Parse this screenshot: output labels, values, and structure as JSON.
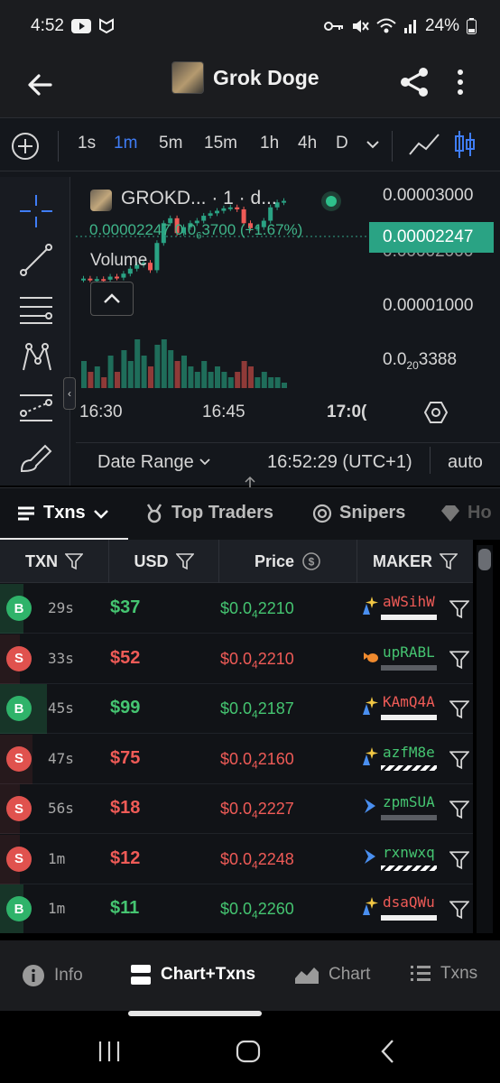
{
  "status_bar": {
    "time": "4:52",
    "battery": "24%"
  },
  "header": {
    "title": "Grok Doge"
  },
  "timeframes": [
    "1s",
    "1m",
    "5m",
    "15m",
    "1h",
    "4h",
    "D"
  ],
  "active_timeframe": "1m",
  "chart": {
    "symbol_title": "GROKD... · 1 · d...",
    "ohlc_prefix": "0.00002247",
    "ohlc_mid": "0.0",
    "ohlc_sub": "6",
    "ohlc_suffix": "3700 (+1.67%)",
    "volume_label": "Volume",
    "current_price_tag": "0.00002247",
    "y_labels": {
      "top": "0.00003000",
      "mid2": "0.00002000",
      "mid1": "0.00001000",
      "low_prefix": "0.0",
      "low_sub": "20",
      "low_suffix": "3388"
    },
    "x_labels": [
      "16:30",
      "16:45",
      "17:0("
    ],
    "date_range_label": "Date Range",
    "time_readout": "16:52:29 (UTC+1)",
    "scale_mode": "auto"
  },
  "chart_data": {
    "type": "candlestick",
    "title": "GROKD... · 1 · d...",
    "xlabel": "",
    "ylabel": "",
    "x_ticks": [
      "16:30",
      "16:45",
      "17:0("
    ],
    "y_ticks": [
      "0.00003000",
      "0.00002000",
      "0.00001000",
      "0.0₂₀3388"
    ],
    "last_price": 2.247e-05,
    "candles": [
      {
        "o": 6.6e-06,
        "c": 6.8e-06,
        "up": true
      },
      {
        "o": 6.8e-06,
        "c": 6.6e-06,
        "up": false
      },
      {
        "o": 6.6e-06,
        "c": 6.7e-06,
        "up": true
      },
      {
        "o": 6.7e-06,
        "c": 6.6e-06,
        "up": false
      },
      {
        "o": 6.6e-06,
        "c": 7.2e-06,
        "up": true
      },
      {
        "o": 7.2e-06,
        "c": 7e-06,
        "up": false
      },
      {
        "o": 7e-06,
        "c": 7.8e-06,
        "up": true
      },
      {
        "o": 7.8e-06,
        "c": 8.8e-06,
        "up": true
      },
      {
        "o": 8.8e-06,
        "c": 9.6e-06,
        "up": true
      },
      {
        "o": 9.6e-06,
        "c": 1e-05,
        "up": true
      },
      {
        "o": 1e-05,
        "c": 8.5e-06,
        "up": false
      },
      {
        "o": 8.5e-06,
        "c": 1.4e-05,
        "up": true
      },
      {
        "o": 1.4e-05,
        "c": 1.8e-05,
        "up": true
      },
      {
        "o": 1.8e-05,
        "c": 1.9e-05,
        "up": true
      },
      {
        "o": 1.9e-05,
        "c": 1.6e-05,
        "up": false
      },
      {
        "o": 1.6e-05,
        "c": 1.72e-05,
        "up": true
      },
      {
        "o": 1.72e-05,
        "c": 1.8e-05,
        "up": true
      },
      {
        "o": 1.8e-05,
        "c": 1.85e-05,
        "up": true
      },
      {
        "o": 1.85e-05,
        "c": 1.95e-05,
        "up": true
      },
      {
        "o": 1.95e-05,
        "c": 2e-05,
        "up": true
      },
      {
        "o": 2e-05,
        "c": 2.05e-05,
        "up": true
      },
      {
        "o": 2.05e-05,
        "c": 2.1e-05,
        "up": true
      },
      {
        "o": 2.1e-05,
        "c": 2.12e-05,
        "up": true
      },
      {
        "o": 2.12e-05,
        "c": 2.08e-05,
        "up": false
      },
      {
        "o": 2.08e-05,
        "c": 1.8e-05,
        "up": false
      },
      {
        "o": 1.8e-05,
        "c": 1.7e-05,
        "up": false
      },
      {
        "o": 1.7e-05,
        "c": 1.72e-05,
        "up": true
      },
      {
        "o": 1.72e-05,
        "c": 1.85e-05,
        "up": true
      },
      {
        "o": 1.85e-05,
        "c": 2.12e-05,
        "up": true
      },
      {
        "o": 2.12e-05,
        "c": 2.22e-05,
        "up": true
      },
      {
        "o": 2.22e-05,
        "c": 2.25e-05,
        "up": true
      }
    ],
    "volumes": [
      0.5,
      0.3,
      0.4,
      0.2,
      0.6,
      0.3,
      0.7,
      0.5,
      0.9,
      0.6,
      0.4,
      0.8,
      0.9,
      0.7,
      0.5,
      0.6,
      0.4,
      0.3,
      0.5,
      0.3,
      0.4,
      0.3,
      0.2,
      0.3,
      0.5,
      0.4,
      0.2,
      0.3,
      0.2,
      0.2,
      0.1
    ]
  },
  "tabs": [
    {
      "label": "Txns",
      "icon": "list-icon"
    },
    {
      "label": "Top Traders",
      "icon": "medal-icon"
    },
    {
      "label": "Snipers",
      "icon": "target-icon"
    },
    {
      "label": "Ho",
      "icon": "diamond-icon"
    }
  ],
  "table": {
    "headers": {
      "txn": "TXN",
      "usd": "USD",
      "price": "Price",
      "maker": "MAKER"
    },
    "rows": [
      {
        "type": "B",
        "age": "29s",
        "usd": "$37",
        "price_prefix": "$0.0",
        "price_sub": "4",
        "price_suffix": "2210",
        "maker": "aWSihW",
        "maker_icon": "sparkle-icon",
        "bar": "solid"
      },
      {
        "type": "S",
        "age": "33s",
        "usd": "$52",
        "price_prefix": "$0.0",
        "price_sub": "4",
        "price_suffix": "2210",
        "maker": "upRABL",
        "maker_icon": "fish-icon",
        "bar": "gray"
      },
      {
        "type": "B",
        "age": "45s",
        "usd": "$99",
        "price_prefix": "$0.0",
        "price_sub": "4",
        "price_suffix": "2187",
        "maker": "KAmQ4A",
        "maker_icon": "sparkle-icon",
        "bar": "solid"
      },
      {
        "type": "S",
        "age": "47s",
        "usd": "$75",
        "price_prefix": "$0.0",
        "price_sub": "4",
        "price_suffix": "2160",
        "maker": "azfM8e",
        "maker_icon": "sparkle-icon",
        "bar": "striped"
      },
      {
        "type": "S",
        "age": "56s",
        "usd": "$18",
        "price_prefix": "$0.0",
        "price_sub": "4",
        "price_suffix": "2227",
        "maker": "zpmSUA",
        "maker_icon": "arrow-icon",
        "bar": "gray"
      },
      {
        "type": "S",
        "age": "1m",
        "usd": "$12",
        "price_prefix": "$0.0",
        "price_sub": "4",
        "price_suffix": "2248",
        "maker": "rxnwxq",
        "maker_icon": "arrow-icon",
        "bar": "striped"
      },
      {
        "type": "B",
        "age": "1m",
        "usd": "$11",
        "price_prefix": "$0.0",
        "price_sub": "4",
        "price_suffix": "2260",
        "maker": "dsaQWu",
        "maker_icon": "sparkle-icon",
        "bar": "solid"
      }
    ]
  },
  "bottom_nav": [
    {
      "label": "Info",
      "icon": "info-icon"
    },
    {
      "label": "Chart+Txns",
      "icon": "split-icon"
    },
    {
      "label": "Chart",
      "icon": "area-chart-icon"
    },
    {
      "label": "Txns",
      "icon": "list-icon"
    }
  ],
  "colors": {
    "buy": "#45c571",
    "sell": "#ef5b57",
    "accent": "#3f7df6",
    "price_tag": "#2aa384"
  }
}
